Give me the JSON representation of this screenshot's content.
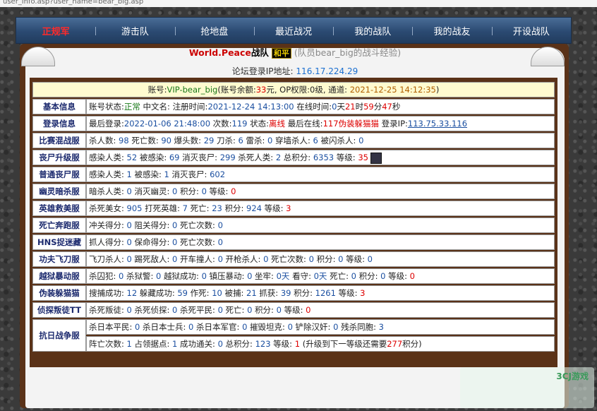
{
  "url_text": "user_info.asp?user_name=bear_big.asp",
  "nav": {
    "items": [
      "正规军",
      "游击队",
      "抢地盘",
      "最近战况",
      "我的战队",
      "我的战友",
      "开设战队"
    ]
  },
  "header": {
    "clan": "World.Peace",
    "zhan": "战队",
    "badge": "和平",
    "rest": "(队员bear_big的战斗经验)",
    "ip_label": "论坛登录IP地址:",
    "ip_value": "116.17.224.29"
  },
  "account": {
    "label": "账号:",
    "user": "VIP-bear_big",
    "bal_label": "(账号余额:",
    "bal": "33",
    "bal_unit": "元,",
    "op_label": "OP权限:",
    "op": "0级,",
    "chan_label": "通道:",
    "chan": "2021-12-25 14:12:35",
    "close": ")"
  },
  "basic": {
    "head": "基本信息",
    "status_label": "账号状态:",
    "status": "正常",
    "cn_label": "中文名:",
    "reg_label": "注册时间:",
    "reg": "2021-12-24 14:13:00",
    "online_label": "在线时间:",
    "online_d": "0",
    "online_h": "21",
    "online_m": "59",
    "online_s": "47",
    "u_d": "天",
    "u_h": "时",
    "u_m": "分",
    "u_s": "秒"
  },
  "login": {
    "head": "登录信息",
    "last_label": "最后登录:",
    "last": "2022-01-06 21:48:00",
    "count_label": "次数:",
    "count": "119",
    "state_label": "状态:",
    "state": "离线",
    "lastin_label": "最后在线:",
    "lastin": "117伪装躲猫猫",
    "ip_label": "登录IP:",
    "ip": "113.75.33.116"
  },
  "rows": [
    {
      "head": "比赛混战服",
      "segs": [
        [
          "杀人数: ",
          ""
        ],
        [
          "98",
          "b"
        ],
        [
          " 死亡数: ",
          ""
        ],
        [
          "90",
          "b"
        ],
        [
          " 爆头数: ",
          ""
        ],
        [
          "29",
          "b"
        ],
        [
          " 刀杀: ",
          ""
        ],
        [
          "6",
          "b"
        ],
        [
          " 雷杀: ",
          ""
        ],
        [
          "0",
          "b"
        ],
        [
          " 穿墙杀人: ",
          ""
        ],
        [
          "6",
          "b"
        ],
        [
          " 被闪杀人: ",
          ""
        ],
        [
          "0",
          "b"
        ]
      ]
    },
    {
      "head": "丧尸升级服",
      "segs": [
        [
          "感染人类: ",
          ""
        ],
        [
          "52",
          "b"
        ],
        [
          " 被感染: ",
          ""
        ],
        [
          "69",
          "b"
        ],
        [
          " 消灭丧尸: ",
          ""
        ],
        [
          "299",
          "b"
        ],
        [
          " 杀死人类: ",
          ""
        ],
        [
          "2",
          "b"
        ],
        [
          " 总积分: ",
          ""
        ],
        [
          "6353",
          "b"
        ],
        [
          " 等级: ",
          ""
        ],
        [
          "35",
          "r"
        ]
      ],
      "avatar": true
    },
    {
      "head": "普通丧尸服",
      "segs": [
        [
          "感染人类: ",
          ""
        ],
        [
          "1",
          "b"
        ],
        [
          " 被感染: ",
          ""
        ],
        [
          "1",
          "b"
        ],
        [
          " 消灭丧尸: ",
          ""
        ],
        [
          "602",
          "b"
        ]
      ]
    },
    {
      "head": "幽灵暗杀服",
      "segs": [
        [
          "暗杀人类: ",
          ""
        ],
        [
          "0",
          "b"
        ],
        [
          " 消灭幽灵: ",
          ""
        ],
        [
          "0",
          "b"
        ],
        [
          " 积分: ",
          ""
        ],
        [
          "0",
          "b"
        ],
        [
          " 等级: ",
          ""
        ],
        [
          "0",
          "r"
        ]
      ]
    },
    {
      "head": "英雄救美服",
      "segs": [
        [
          "杀死美女: ",
          ""
        ],
        [
          "905",
          "b"
        ],
        [
          " 打死英雄: ",
          ""
        ],
        [
          "7",
          "b"
        ],
        [
          " 死亡: ",
          ""
        ],
        [
          "23",
          "b"
        ],
        [
          " 积分: ",
          ""
        ],
        [
          "924",
          "b"
        ],
        [
          " 等级: ",
          ""
        ],
        [
          "3",
          "r"
        ]
      ]
    },
    {
      "head": "死亡奔跑服",
      "segs": [
        [
          "冲关得分: ",
          ""
        ],
        [
          "0",
          "b"
        ],
        [
          " 阻关得分: ",
          ""
        ],
        [
          "0",
          "b"
        ],
        [
          " 死亡次数: ",
          ""
        ],
        [
          "0",
          "b"
        ]
      ]
    },
    {
      "head": "HNS捉迷藏",
      "segs": [
        [
          "抓人得分: ",
          ""
        ],
        [
          "0",
          "b"
        ],
        [
          " 保命得分: ",
          ""
        ],
        [
          "0",
          "b"
        ],
        [
          " 死亡次数: ",
          ""
        ],
        [
          "0",
          "b"
        ]
      ]
    },
    {
      "head": "功夫飞刀服",
      "segs": [
        [
          "飞刀杀人: ",
          ""
        ],
        [
          "0",
          "b"
        ],
        [
          " 踢死敌人: ",
          ""
        ],
        [
          "0",
          "b"
        ],
        [
          " 开车撞人: ",
          ""
        ],
        [
          "0",
          "b"
        ],
        [
          " 开枪杀人: ",
          ""
        ],
        [
          "0",
          "b"
        ],
        [
          " 死亡次数: ",
          ""
        ],
        [
          "0",
          "b"
        ],
        [
          " 积分: ",
          ""
        ],
        [
          "0",
          "b"
        ],
        [
          " 等级: ",
          ""
        ],
        [
          "0",
          "b"
        ]
      ]
    },
    {
      "head": "越狱暴动服",
      "segs": [
        [
          "杀囚犯: ",
          ""
        ],
        [
          "0",
          "b"
        ],
        [
          " 杀狱警: ",
          ""
        ],
        [
          "0",
          "b"
        ],
        [
          " 越狱成功: ",
          ""
        ],
        [
          "0",
          "b"
        ],
        [
          " 镇压暴动: ",
          ""
        ],
        [
          "0",
          "b"
        ],
        [
          " 坐牢: ",
          ""
        ],
        [
          "0天",
          "b"
        ],
        [
          " 看守: ",
          ""
        ],
        [
          "0天",
          "b"
        ],
        [
          " 死亡: ",
          ""
        ],
        [
          "0",
          "b"
        ],
        [
          " 积分: ",
          ""
        ],
        [
          "0",
          "b"
        ],
        [
          " 等级: ",
          ""
        ],
        [
          "0",
          "r"
        ]
      ]
    },
    {
      "head": "伪装躲猫猫",
      "segs": [
        [
          "搜捕成功: ",
          ""
        ],
        [
          "12",
          "b"
        ],
        [
          " 躲藏成功: ",
          ""
        ],
        [
          "59",
          "b"
        ],
        [
          " 作死: ",
          ""
        ],
        [
          "10",
          "b"
        ],
        [
          " 被捕: ",
          ""
        ],
        [
          "21",
          "b"
        ],
        [
          " 抓获: ",
          ""
        ],
        [
          "39",
          "b"
        ],
        [
          " 积分: ",
          ""
        ],
        [
          "1261",
          "b"
        ],
        [
          " 等级: ",
          ""
        ],
        [
          "3",
          "r"
        ]
      ]
    },
    {
      "head": "侦探叛徒TT",
      "segs": [
        [
          "杀死叛徒: ",
          ""
        ],
        [
          "0",
          "b"
        ],
        [
          " 杀死侦探: ",
          ""
        ],
        [
          "0",
          "b"
        ],
        [
          " 杀死平民: ",
          ""
        ],
        [
          "0",
          "b"
        ],
        [
          " 死亡: ",
          ""
        ],
        [
          "0",
          "b"
        ],
        [
          " 积分: ",
          ""
        ],
        [
          "0",
          "b"
        ],
        [
          " 等级: ",
          ""
        ],
        [
          "0",
          "r"
        ]
      ]
    }
  ],
  "war": {
    "head": "抗日战争服",
    "line1": [
      [
        "杀日本平民: ",
        ""
      ],
      [
        "0",
        "b"
      ],
      [
        " 杀日本士兵: ",
        ""
      ],
      [
        "0",
        "b"
      ],
      [
        " 杀日本军官: ",
        ""
      ],
      [
        "0",
        "b"
      ],
      [
        " 摧毁坦克: ",
        ""
      ],
      [
        "0",
        "b"
      ],
      [
        " 铲除汉奸: ",
        ""
      ],
      [
        "0",
        "b"
      ],
      [
        " 残杀同胞: ",
        ""
      ],
      [
        "3",
        "b"
      ]
    ],
    "line2": [
      [
        "阵亡次数: ",
        ""
      ],
      [
        "1",
        "b"
      ],
      [
        " 占领据点: ",
        ""
      ],
      [
        "1",
        "b"
      ],
      [
        " 成功通关: ",
        ""
      ],
      [
        "0",
        "b"
      ],
      [
        " 总积分: ",
        ""
      ],
      [
        "123",
        "b"
      ],
      [
        " 等级: ",
        ""
      ],
      [
        "1",
        "r"
      ],
      [
        " (升级到下一等级还需要",
        ""
      ],
      [
        "277",
        "r"
      ],
      [
        "积分)",
        ""
      ]
    ]
  },
  "watermark": "3CJ游戏"
}
